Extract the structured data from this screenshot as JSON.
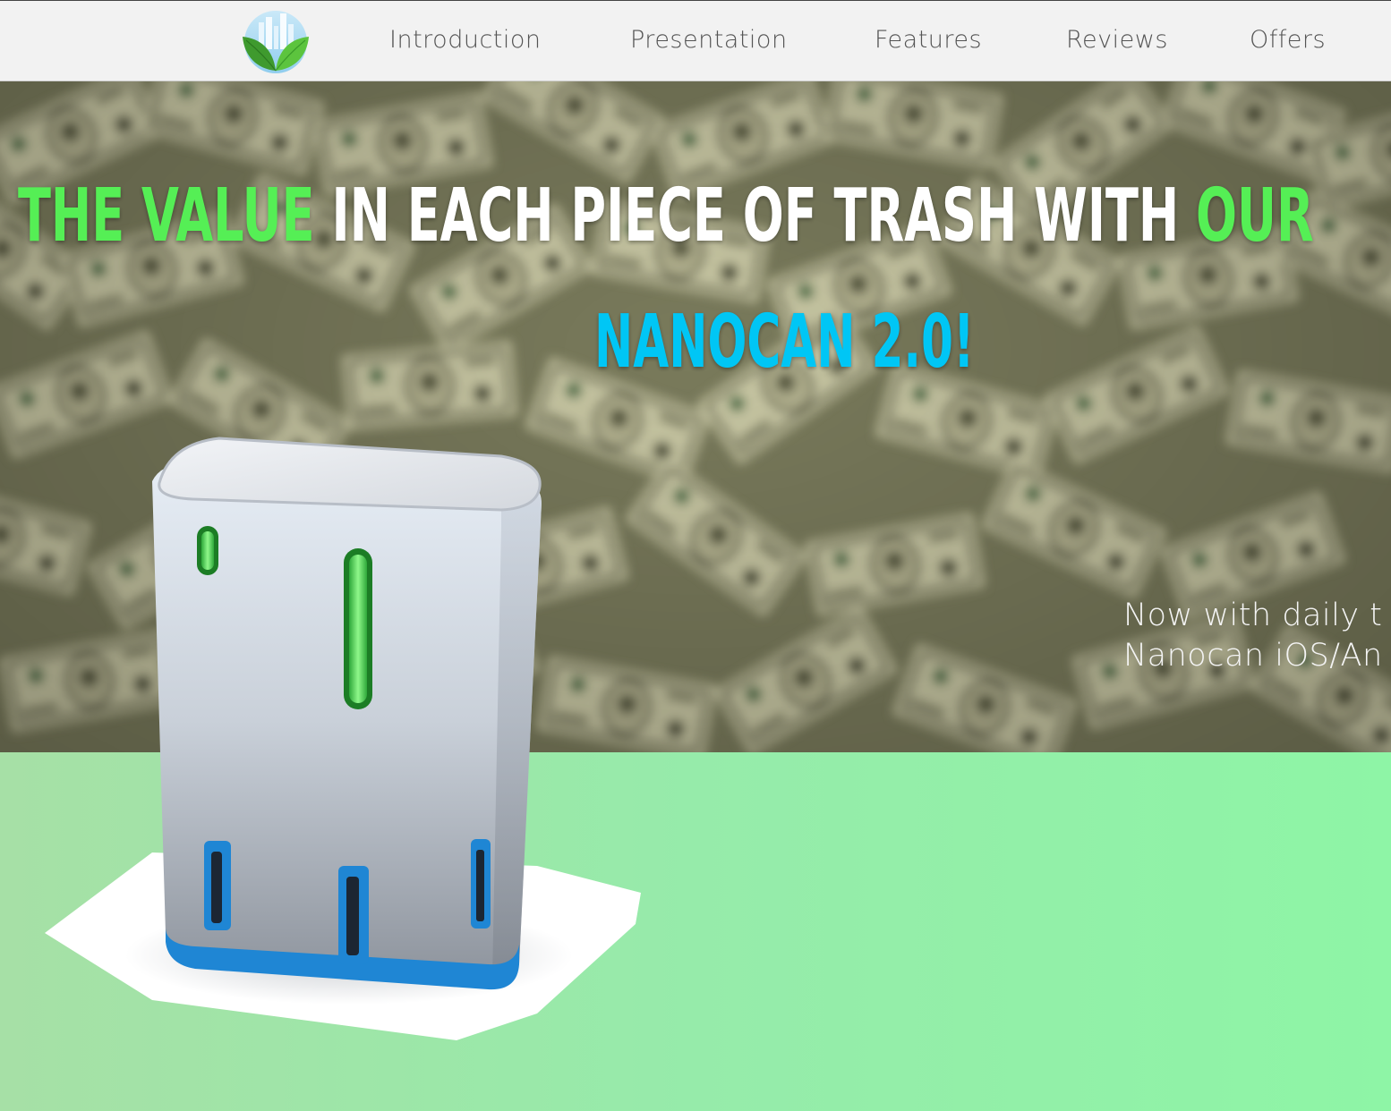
{
  "nav": {
    "logo_icon": "leaf-city-logo-icon",
    "items": [
      {
        "label": "Introduction"
      },
      {
        "label": "Presentation"
      },
      {
        "label": "Features"
      },
      {
        "label": "Reviews"
      },
      {
        "label": "Offers"
      }
    ]
  },
  "hero": {
    "headline": {
      "part1": "THE VALUE",
      "part2": " IN EACH PIECE OF TRASH WITH ",
      "part3": "OUR",
      "line2": "NANOCAN 2.0!"
    },
    "tagline": {
      "line1": "Now with daily t",
      "line2": "Nanocan iOS/An"
    },
    "background": "money-bills-background",
    "colors": {
      "headline_green": "#55ef55",
      "headline_white": "#ffffff",
      "product_blue": "#00c6f5",
      "lower_green": "#93eda6"
    }
  },
  "product": {
    "image": "nanocan-trash-bin-image"
  }
}
